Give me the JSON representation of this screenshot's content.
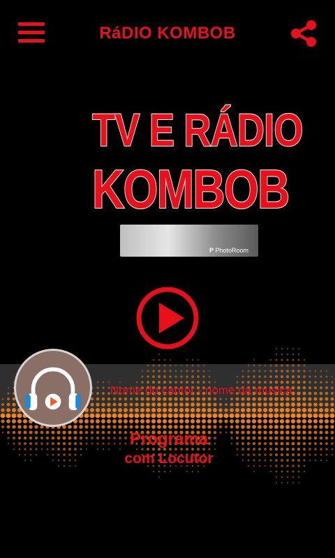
{
  "header": {
    "title": "RáDIO KOMBOB",
    "menu_icon": "hamburger-menu-icon",
    "share_icon": "share-icon"
  },
  "logo": {
    "line1": "TV E RÁDIO",
    "line2": "KOMBOB",
    "watermark": "PhotoRoom"
  },
  "player": {
    "play_icon": "play-icon",
    "track": "Nome do cantor - nome da musica",
    "program_title": "Programa",
    "program_host": "com Locutor",
    "album_art_icon": "headphones-play-icon"
  },
  "colors": {
    "accent": "#e8101a",
    "background": "#000000",
    "dots": "#f5851f"
  }
}
